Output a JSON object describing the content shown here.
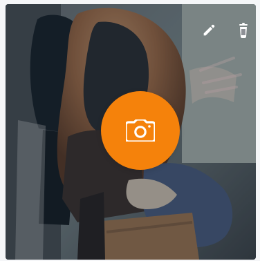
{
  "photo_upload": {
    "accent_color": "#f5820b",
    "overlay_color": "rgba(0,0,0,0.28)",
    "actions": [
      {
        "id": "edit",
        "icon": "pencil-icon"
      },
      {
        "id": "delete",
        "icon": "trash-icon"
      }
    ],
    "main_action": {
      "icon": "camera-icon"
    }
  }
}
